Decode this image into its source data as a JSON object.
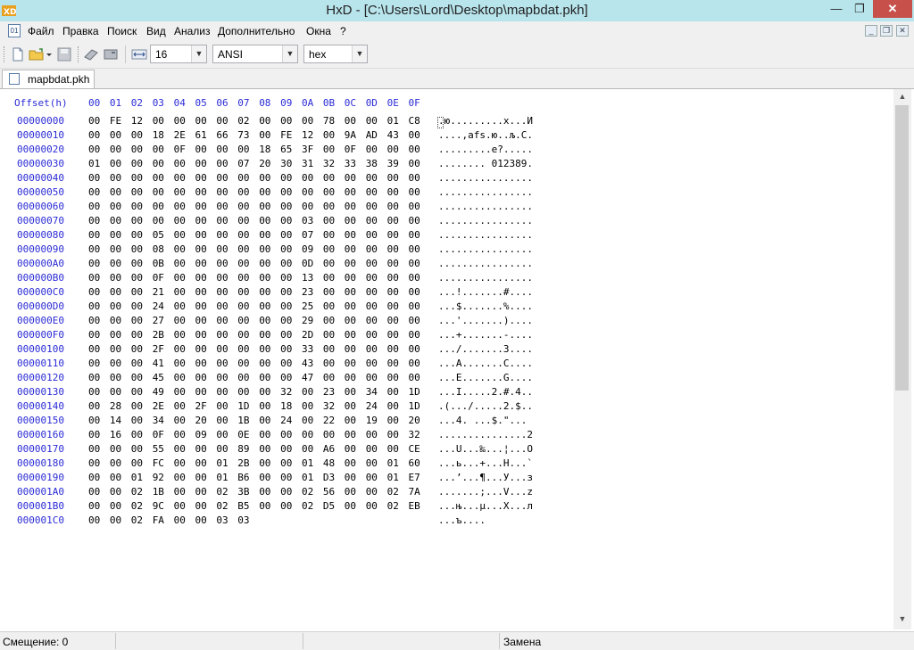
{
  "window": {
    "title": "HxD - [C:\\Users\\Lord\\Desktop\\mapbdat.pkh]",
    "app_icon": "hxd-logo-icon",
    "minimize": "—",
    "restore": "❐",
    "close": "✕"
  },
  "menu": {
    "items": [
      "Файл",
      "Правка",
      "Поиск",
      "Вид",
      "Анализ",
      "Дополнительно",
      "Окна",
      "?"
    ]
  },
  "toolbar": {
    "icons": [
      "new-file-icon",
      "open-file-icon",
      "save-icon",
      "ram-icon",
      "disk-icon"
    ],
    "bytes_per_row": "16",
    "charset": "ANSI",
    "offset_base": "hex"
  },
  "tab": {
    "label": "mapbdat.pkh"
  },
  "hex": {
    "offset_header": "Offset(h)",
    "columns": [
      "00",
      "01",
      "02",
      "03",
      "04",
      "05",
      "06",
      "07",
      "08",
      "09",
      "0A",
      "0B",
      "0C",
      "0D",
      "0E",
      "0F"
    ],
    "rows": [
      {
        "off": "00000000",
        "bytes": [
          "00",
          "FE",
          "12",
          "00",
          "00",
          "00",
          "00",
          "02",
          "00",
          "00",
          "00",
          "78",
          "00",
          "00",
          "01",
          "C8"
        ],
        "ascii": ".ю.........x...И"
      },
      {
        "off": "00000010",
        "bytes": [
          "00",
          "00",
          "00",
          "18",
          "2E",
          "61",
          "66",
          "73",
          "00",
          "FE",
          "12",
          "00",
          "9A",
          "AD",
          "43",
          "00"
        ],
        "ascii": "....,afs.ю..љ.C."
      },
      {
        "off": "00000020",
        "bytes": [
          "00",
          "00",
          "00",
          "00",
          "0F",
          "00",
          "00",
          "00",
          "18",
          "65",
          "3F",
          "00",
          "0F",
          "00",
          "00",
          "00"
        ],
        "ascii": ".........e?....."
      },
      {
        "off": "00000030",
        "bytes": [
          "01",
          "00",
          "00",
          "00",
          "00",
          "00",
          "00",
          "07",
          "20",
          "30",
          "31",
          "32",
          "33",
          "38",
          "39",
          "00"
        ],
        "ascii": "........ 012389."
      },
      {
        "off": "00000040",
        "bytes": [
          "00",
          "00",
          "00",
          "00",
          "00",
          "00",
          "00",
          "00",
          "00",
          "00",
          "00",
          "00",
          "00",
          "00",
          "00",
          "00"
        ],
        "ascii": "................"
      },
      {
        "off": "00000050",
        "bytes": [
          "00",
          "00",
          "00",
          "00",
          "00",
          "00",
          "00",
          "00",
          "00",
          "00",
          "00",
          "00",
          "00",
          "00",
          "00",
          "00"
        ],
        "ascii": "................"
      },
      {
        "off": "00000060",
        "bytes": [
          "00",
          "00",
          "00",
          "00",
          "00",
          "00",
          "00",
          "00",
          "00",
          "00",
          "00",
          "00",
          "00",
          "00",
          "00",
          "00"
        ],
        "ascii": "................"
      },
      {
        "off": "00000070",
        "bytes": [
          "00",
          "00",
          "00",
          "00",
          "00",
          "00",
          "00",
          "00",
          "00",
          "00",
          "03",
          "00",
          "00",
          "00",
          "00",
          "00"
        ],
        "ascii": "................"
      },
      {
        "off": "00000080",
        "bytes": [
          "00",
          "00",
          "00",
          "05",
          "00",
          "00",
          "00",
          "00",
          "00",
          "00",
          "07",
          "00",
          "00",
          "00",
          "00",
          "00"
        ],
        "ascii": "................"
      },
      {
        "off": "00000090",
        "bytes": [
          "00",
          "00",
          "00",
          "08",
          "00",
          "00",
          "00",
          "00",
          "00",
          "00",
          "09",
          "00",
          "00",
          "00",
          "00",
          "00"
        ],
        "ascii": "................"
      },
      {
        "off": "000000A0",
        "bytes": [
          "00",
          "00",
          "00",
          "0B",
          "00",
          "00",
          "00",
          "00",
          "00",
          "00",
          "0D",
          "00",
          "00",
          "00",
          "00",
          "00"
        ],
        "ascii": "................"
      },
      {
        "off": "000000B0",
        "bytes": [
          "00",
          "00",
          "00",
          "0F",
          "00",
          "00",
          "00",
          "00",
          "00",
          "00",
          "13",
          "00",
          "00",
          "00",
          "00",
          "00"
        ],
        "ascii": "................"
      },
      {
        "off": "000000C0",
        "bytes": [
          "00",
          "00",
          "00",
          "21",
          "00",
          "00",
          "00",
          "00",
          "00",
          "00",
          "23",
          "00",
          "00",
          "00",
          "00",
          "00"
        ],
        "ascii": "...!.......#...."
      },
      {
        "off": "000000D0",
        "bytes": [
          "00",
          "00",
          "00",
          "24",
          "00",
          "00",
          "00",
          "00",
          "00",
          "00",
          "25",
          "00",
          "00",
          "00",
          "00",
          "00"
        ],
        "ascii": "...$.......%...."
      },
      {
        "off": "000000E0",
        "bytes": [
          "00",
          "00",
          "00",
          "27",
          "00",
          "00",
          "00",
          "00",
          "00",
          "00",
          "29",
          "00",
          "00",
          "00",
          "00",
          "00"
        ],
        "ascii": "...'.......)...."
      },
      {
        "off": "000000F0",
        "bytes": [
          "00",
          "00",
          "00",
          "2B",
          "00",
          "00",
          "00",
          "00",
          "00",
          "00",
          "2D",
          "00",
          "00",
          "00",
          "00",
          "00"
        ],
        "ascii": "...+.......-...."
      },
      {
        "off": "00000100",
        "bytes": [
          "00",
          "00",
          "00",
          "2F",
          "00",
          "00",
          "00",
          "00",
          "00",
          "00",
          "33",
          "00",
          "00",
          "00",
          "00",
          "00"
        ],
        "ascii": ".../.......3...."
      },
      {
        "off": "00000110",
        "bytes": [
          "00",
          "00",
          "00",
          "41",
          "00",
          "00",
          "00",
          "00",
          "00",
          "00",
          "43",
          "00",
          "00",
          "00",
          "00",
          "00"
        ],
        "ascii": "...A.......C...."
      },
      {
        "off": "00000120",
        "bytes": [
          "00",
          "00",
          "00",
          "45",
          "00",
          "00",
          "00",
          "00",
          "00",
          "00",
          "47",
          "00",
          "00",
          "00",
          "00",
          "00"
        ],
        "ascii": "...E.......G...."
      },
      {
        "off": "00000130",
        "bytes": [
          "00",
          "00",
          "00",
          "49",
          "00",
          "00",
          "00",
          "00",
          "00",
          "32",
          "00",
          "23",
          "00",
          "34",
          "00",
          "1D"
        ],
        "ascii": "...I.....2.#.4.."
      },
      {
        "off": "00000140",
        "bytes": [
          "00",
          "28",
          "00",
          "2E",
          "00",
          "2F",
          "00",
          "1D",
          "00",
          "18",
          "00",
          "32",
          "00",
          "24",
          "00",
          "1D"
        ],
        "ascii": ".(.../.....2.$.."
      },
      {
        "off": "00000150",
        "bytes": [
          "00",
          "14",
          "00",
          "34",
          "00",
          "20",
          "00",
          "1B",
          "00",
          "24",
          "00",
          "22",
          "00",
          "19",
          "00",
          "20"
        ],
        "ascii": "...4. ...$.\"... "
      },
      {
        "off": "00000160",
        "bytes": [
          "00",
          "16",
          "00",
          "0F",
          "00",
          "09",
          "00",
          "0E",
          "00",
          "00",
          "00",
          "00",
          "00",
          "00",
          "00",
          "32"
        ],
        "ascii": "...............2"
      },
      {
        "off": "00000170",
        "bytes": [
          "00",
          "00",
          "00",
          "55",
          "00",
          "00",
          "00",
          "89",
          "00",
          "00",
          "00",
          "A6",
          "00",
          "00",
          "00",
          "CE"
        ],
        "ascii": "...U...‰...¦...О"
      },
      {
        "off": "00000180",
        "bytes": [
          "00",
          "00",
          "00",
          "FC",
          "00",
          "00",
          "01",
          "2B",
          "00",
          "00",
          "01",
          "48",
          "00",
          "00",
          "01",
          "60"
        ],
        "ascii": "...ь...+...H...`"
      },
      {
        "off": "00000190",
        "bytes": [
          "00",
          "00",
          "01",
          "92",
          "00",
          "00",
          "01",
          "B6",
          "00",
          "00",
          "01",
          "D3",
          "00",
          "00",
          "01",
          "E7"
        ],
        "ascii": "...’...¶...У...з"
      },
      {
        "off": "000001A0",
        "bytes": [
          "00",
          "00",
          "02",
          "1B",
          "00",
          "00",
          "02",
          "3B",
          "00",
          "00",
          "02",
          "56",
          "00",
          "00",
          "02",
          "7A"
        ],
        "ascii": ".......;...V...z"
      },
      {
        "off": "000001B0",
        "bytes": [
          "00",
          "00",
          "02",
          "9C",
          "00",
          "00",
          "02",
          "B5",
          "00",
          "00",
          "02",
          "D5",
          "00",
          "00",
          "02",
          "EB"
        ],
        "ascii": "...њ...µ...Х...л"
      },
      {
        "off": "000001C0",
        "bytes": [
          "00",
          "00",
          "02",
          "FA",
          "00",
          "00",
          "03",
          "03"
        ],
        "ascii": "...ъ...."
      }
    ]
  },
  "status": {
    "offset": "Смещение: 0",
    "mode": "Замена"
  }
}
